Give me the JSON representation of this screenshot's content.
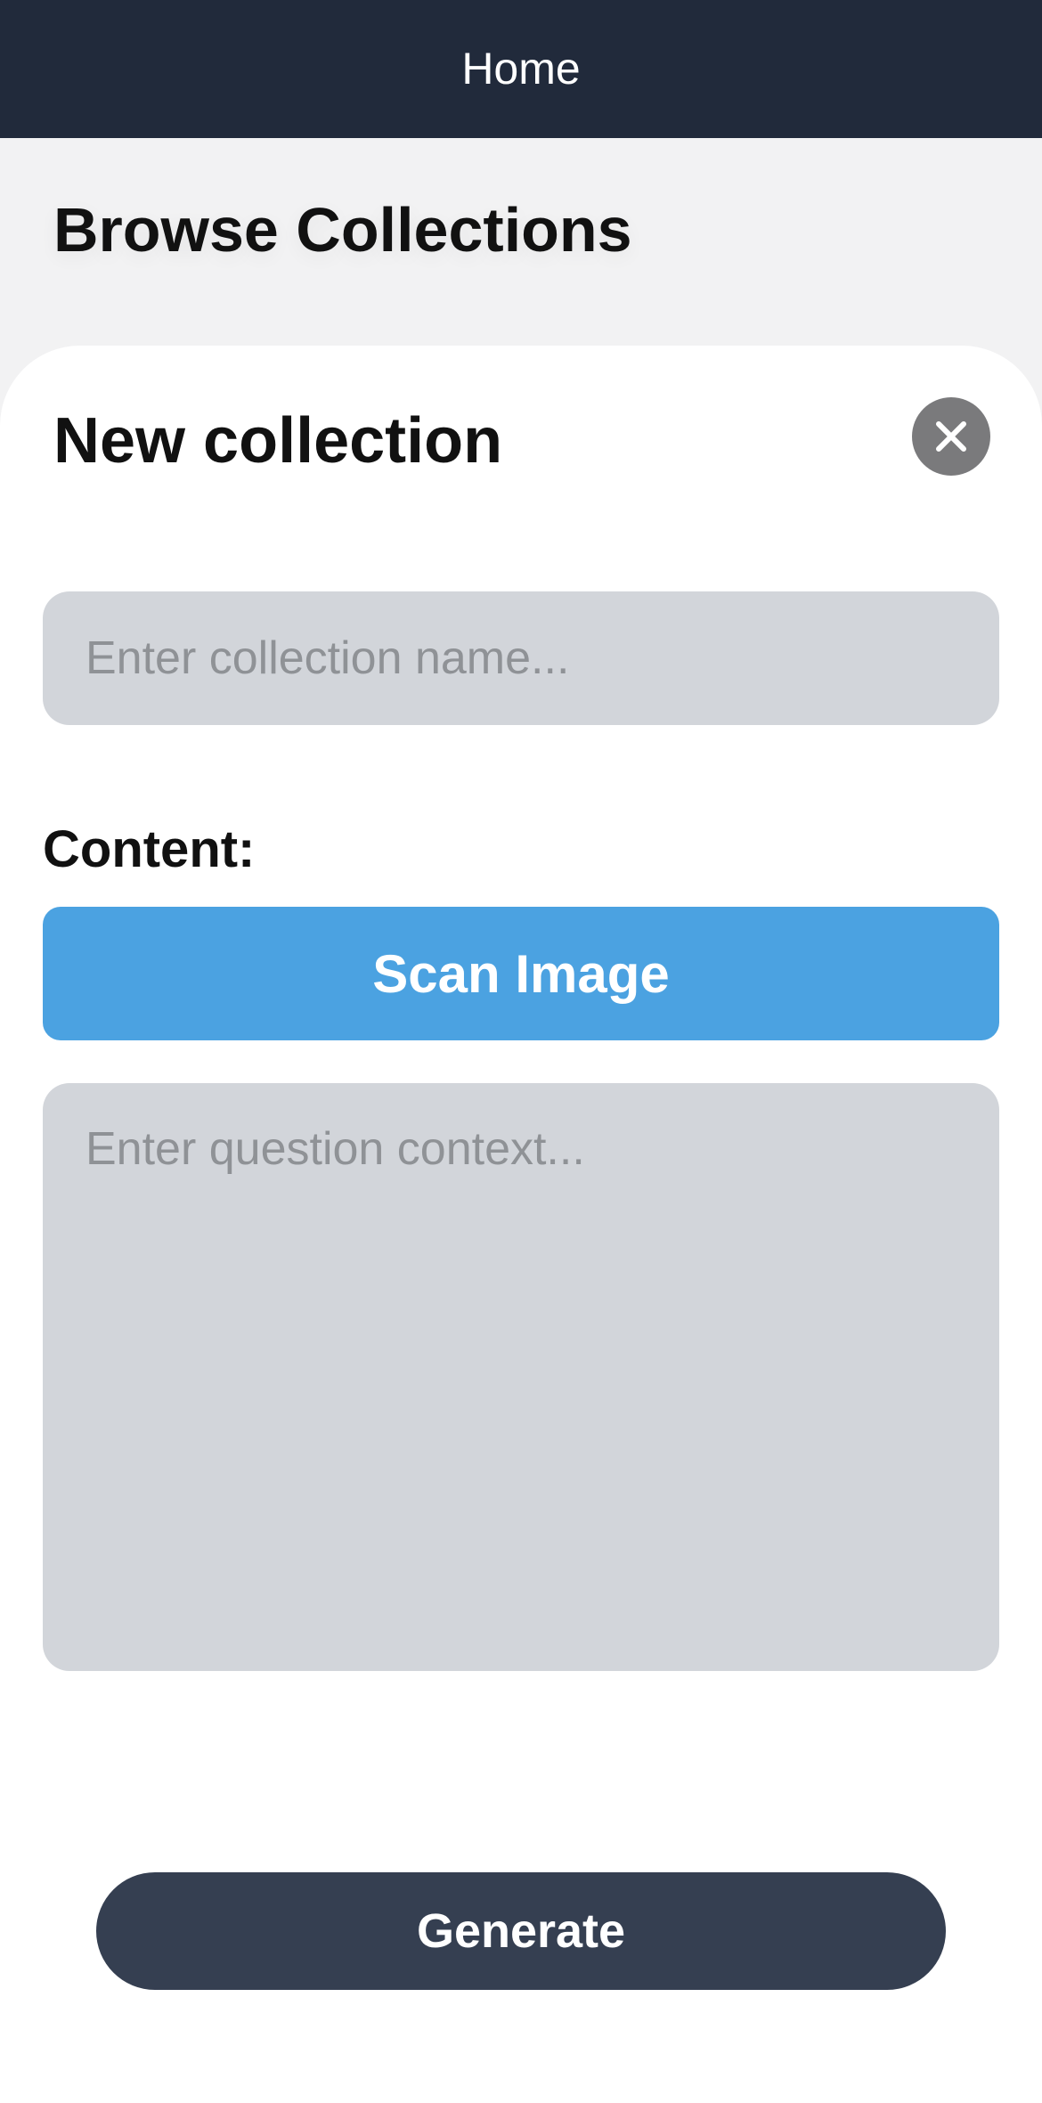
{
  "header": {
    "title": "Home"
  },
  "page": {
    "title": "Browse Collections"
  },
  "sheet": {
    "title": "New collection",
    "close_icon": "close-icon",
    "name_field": {
      "value": "",
      "placeholder": "Enter collection name..."
    },
    "content_label": "Content:",
    "scan_button_label": "Scan Image",
    "context_field": {
      "value": "",
      "placeholder": "Enter question context..."
    },
    "generate_button_label": "Generate"
  },
  "colors": {
    "header_bg": "#212a3b",
    "scan_button": "#4ba2e1",
    "generate_button": "#353f51",
    "input_bg": "#d2d5da",
    "close_button": "#7a7a7c"
  }
}
